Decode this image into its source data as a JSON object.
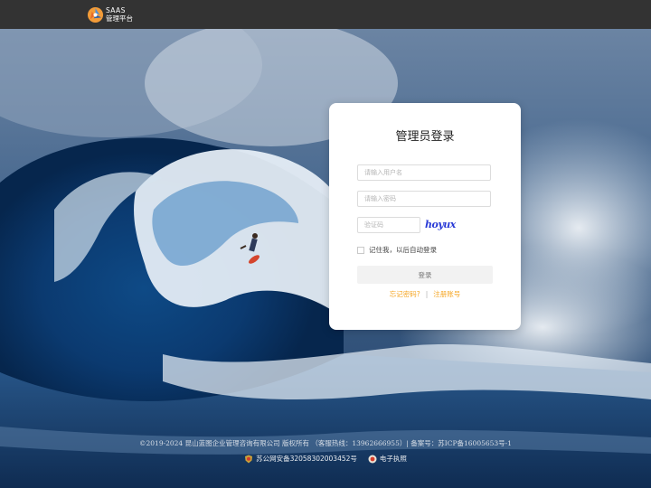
{
  "header": {
    "logo_line1": "SAAS",
    "logo_line2": "管理平台"
  },
  "login": {
    "title": "管理员登录",
    "username_placeholder": "请输入用户名",
    "password_placeholder": "请输入密码",
    "captcha_placeholder": "验证码",
    "captcha_text": "hoyux",
    "remember_label": "记住我，以后自动登录",
    "submit_label": "登录",
    "forgot_label": "忘记密码?",
    "link_separator": "|",
    "register_label": "注册账号"
  },
  "footer": {
    "copyright": "©2019-2024 昆山蓝图企业管理咨询有限公司 版权所有 （客服热线：13962666955）| 备案号：苏ICP备16005653号-1",
    "police_record": "苏公网安备32058302003452号",
    "business_license": "电子执照"
  },
  "colors": {
    "topbar": "#333333",
    "link_accent": "#f5a623",
    "captcha": "#2a3bd6"
  }
}
